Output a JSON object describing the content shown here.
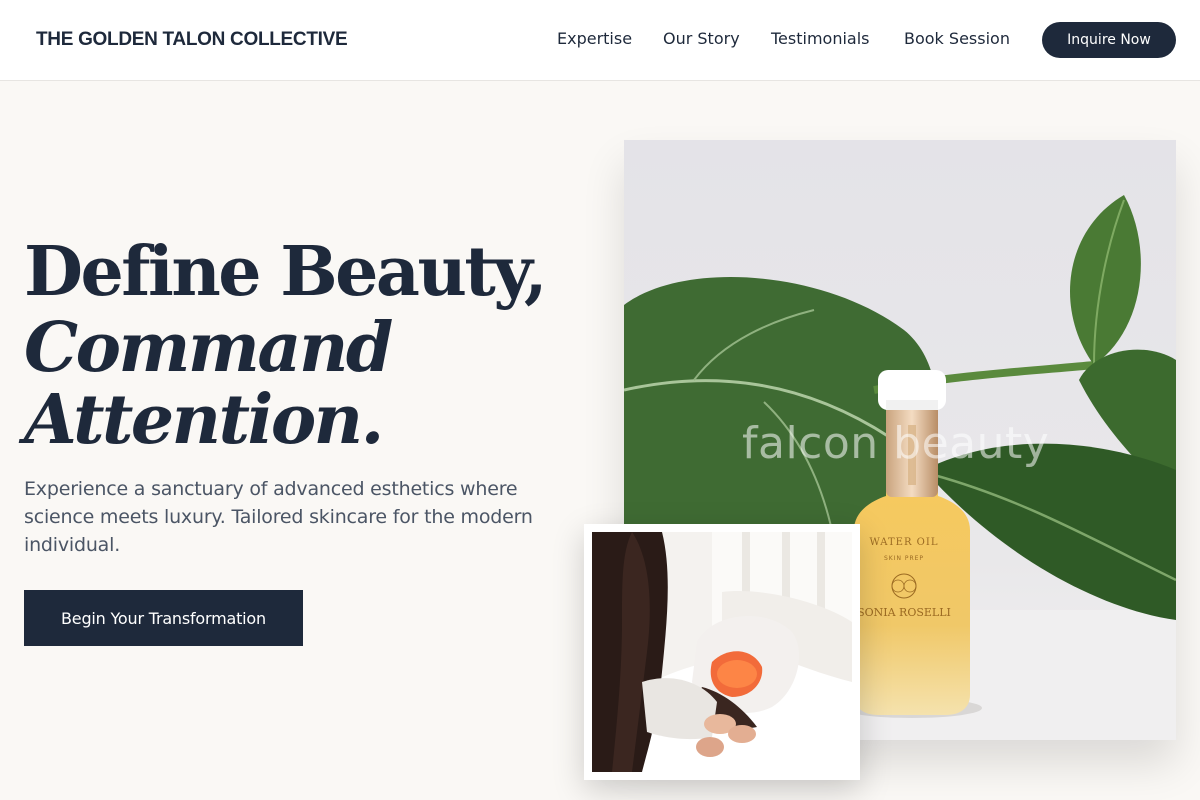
{
  "header": {
    "brand": "THE GOLDEN TALON COLLECTIVE",
    "nav": [
      "Expertise",
      "Our Story",
      "Testimonials",
      "Book Session"
    ],
    "cta_label": "Inquire Now"
  },
  "hero": {
    "title_line1": "Define Beauty,",
    "title_line2": "Command",
    "title_line3": "Attention.",
    "subtitle": "Experience a sanctuary of advanced esthetics where science meets luxury. Tailored skincare for the modern individual.",
    "cta_label": "Begin Your Transformation"
  },
  "main_image": {
    "watermark": "falcon beauty",
    "bottle_label_line1": "WATER OIL",
    "bottle_label_line2": "SKIN PREP",
    "bottle_brand": "SONIA ROSELLI"
  },
  "colors": {
    "navy": "#1e293b",
    "background": "#faf8f5",
    "text_muted": "#4b5565"
  }
}
